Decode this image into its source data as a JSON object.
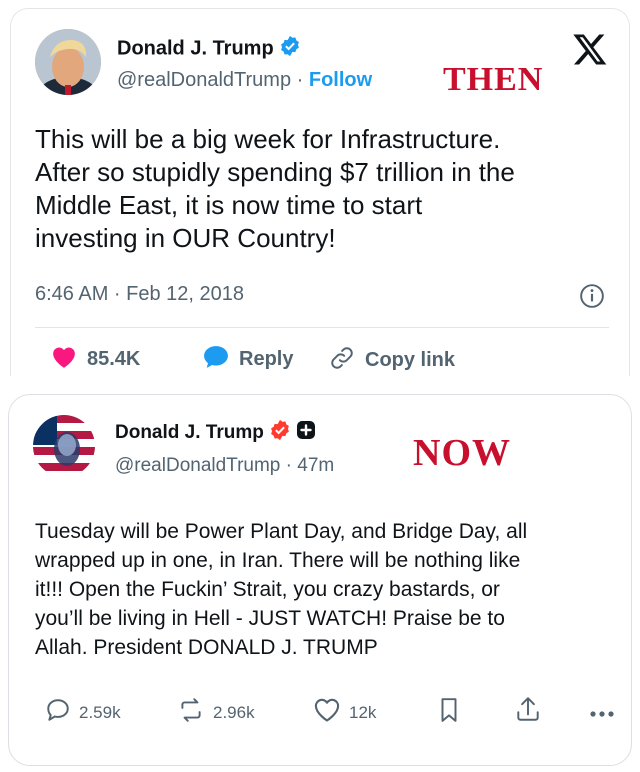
{
  "then_tweet": {
    "name": "Donald J. Trump",
    "handle": "@realDonaldTrump",
    "separator": "·",
    "follow": "Follow",
    "stamp": "THEN",
    "platform_logo": "X",
    "text_lines": [
      "This will be a big week for Infrastructure.",
      "After so stupidly spending $7 trillion in the",
      "Middle East, it is now time to start",
      "investing in OUR Country!"
    ],
    "timestamp": "6:46 AM · Feb 12, 2018",
    "likes": "85.4K",
    "reply": "Reply",
    "copy_link": "Copy link",
    "colors": {
      "like": "#f91880",
      "reply": "#1d9bf0",
      "follow": "#1d9bf0",
      "stamp": "#c8102e"
    },
    "icons": [
      "verified-badge-icon",
      "x-logo-icon",
      "info-icon",
      "heart-icon",
      "reply-bubble-icon",
      "link-icon"
    ]
  },
  "now_post": {
    "name": "Donald J. Trump",
    "handle": "@realDonaldTrump · 47m",
    "stamp": "NOW",
    "text_lines": [
      "Tuesday will be Power Plant Day, and Bridge Day, all",
      "wrapped up in one, in Iran. There will be nothing like",
      "it!!! Open the Fuckin’ Strait, you crazy bastards, or",
      "you’ll be living in Hell - JUST WATCH! Praise be to",
      "Allah. President DONALD J. TRUMP"
    ],
    "replies": "2.59k",
    "reposts": "2.96k",
    "likes": "12k",
    "colors": {
      "badge": "#ff3b30",
      "icon": "#536471"
    },
    "icons": [
      "verified-badge-icon",
      "plus-badge-icon",
      "comment-icon",
      "repost-icon",
      "heart-outline-icon",
      "bookmark-icon",
      "share-icon",
      "more-icon"
    ]
  }
}
